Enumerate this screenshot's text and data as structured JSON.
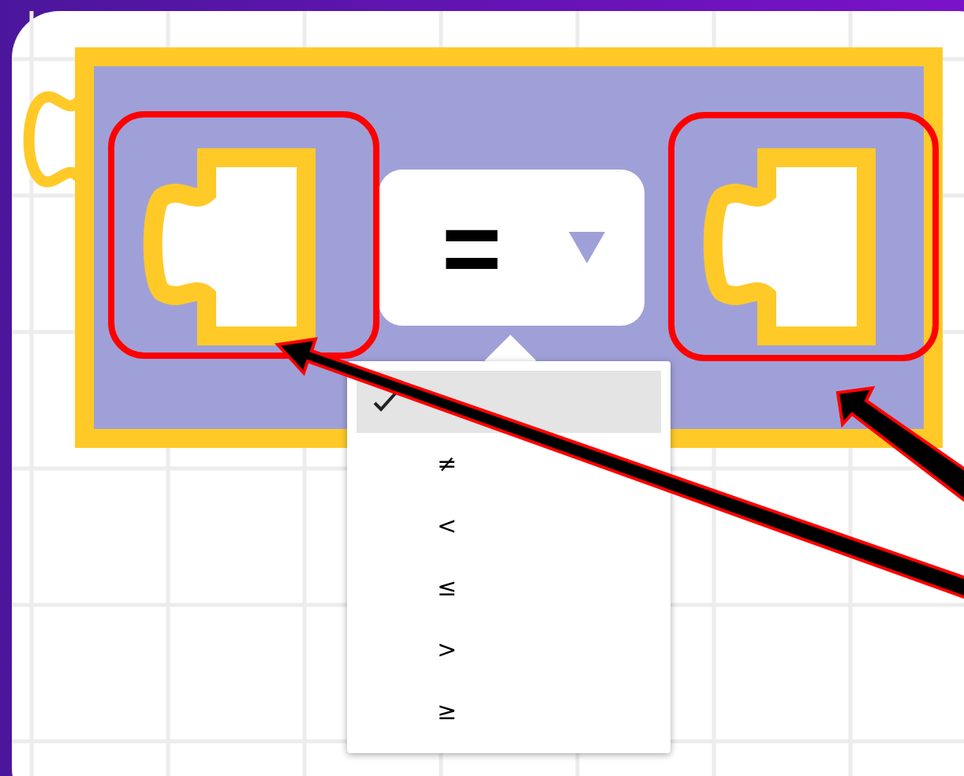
{
  "block": {
    "operator": "="
  },
  "dropdown": {
    "items": [
      {
        "selected": true
      },
      {
        "label": "≠",
        "selected": false
      },
      {
        "label": "<",
        "selected": false
      },
      {
        "label": "≤",
        "selected": false
      },
      {
        "label": ">",
        "selected": false
      },
      {
        "label": "≥",
        "selected": false
      }
    ]
  }
}
